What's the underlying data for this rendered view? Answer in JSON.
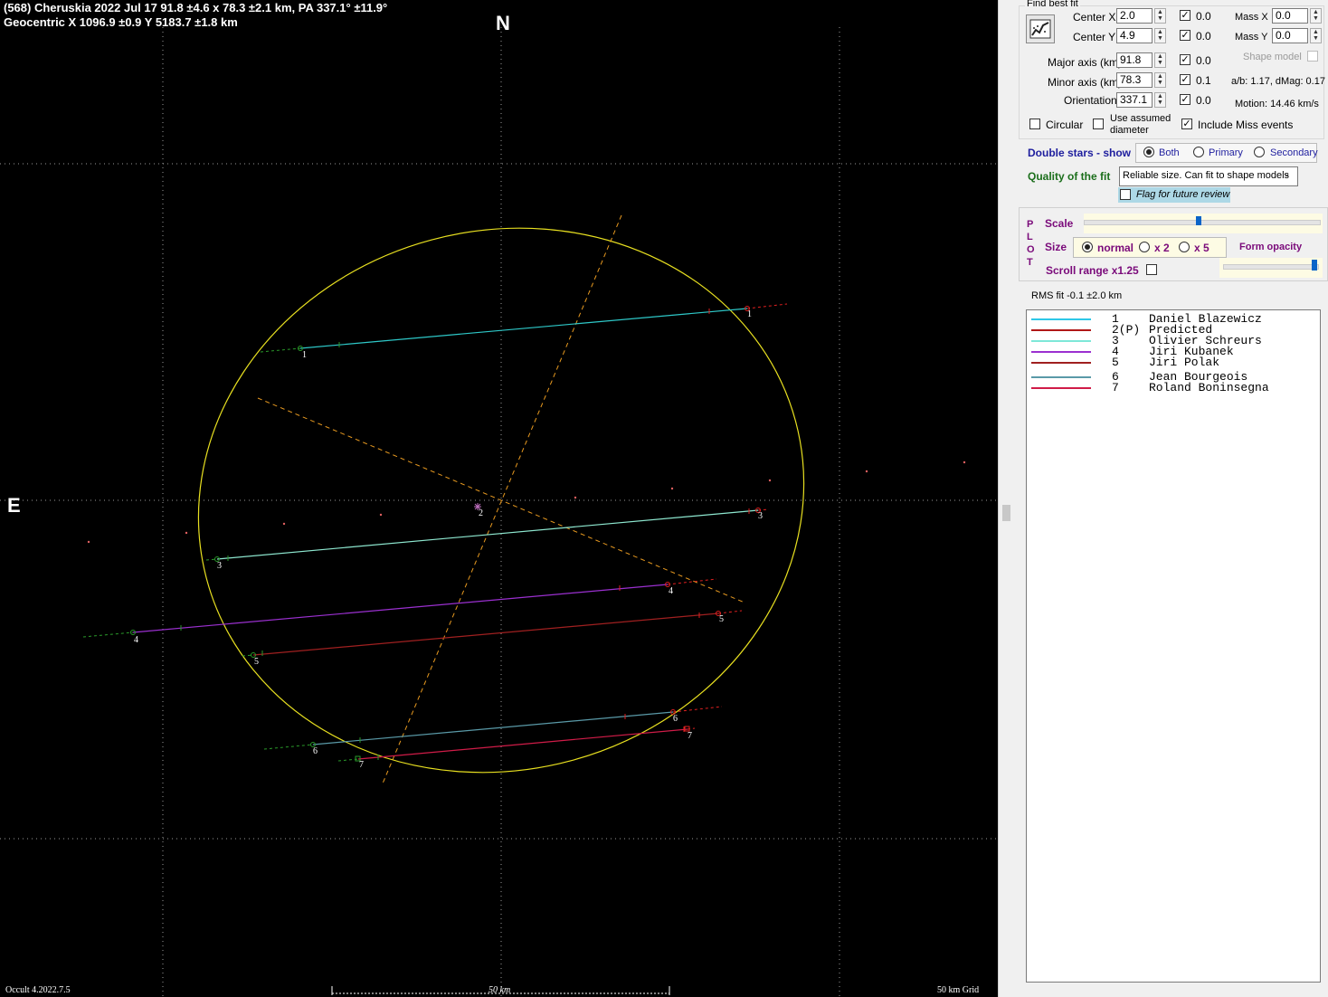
{
  "plot": {
    "title_line1": "(568) Cheruskia  2022 Jul 17  91.8 ±4.6 x 78.3 ±2.1 km, PA 337.1° ±11.9°",
    "title_line2": "Geocentric  X  1096.9 ±0.9  Y 5183.7 ±1.8 km",
    "north_label": "N",
    "east_label": "E",
    "version_label": "Occult 4.2022.7.5",
    "scale_bar_label": "50 km",
    "grid_label": "50 km Grid",
    "chords": [
      {
        "id": "1",
        "color": "#2ec8c8"
      },
      {
        "id": "3",
        "color": "#8ee8d0"
      },
      {
        "id": "4",
        "color": "#9b30d0"
      },
      {
        "id": "5",
        "color": "#a02020"
      },
      {
        "id": "6",
        "color": "#5a9aa8"
      },
      {
        "id": "7",
        "color": "#d01c48"
      }
    ],
    "predicted_label": "2",
    "ellipse_color": "#e8e020"
  },
  "panel": {
    "find_best_fit": "Find best fit",
    "center_x": {
      "label": "Center X",
      "value": "2.0",
      "check_value": "0.0"
    },
    "center_y": {
      "label": "Center Y",
      "value": "4.9",
      "check_value": "0.0"
    },
    "mass_x": {
      "label": "Mass X",
      "value": "0.0"
    },
    "mass_y": {
      "label": "Mass Y",
      "value": "0.0"
    },
    "shape_model": "Shape model",
    "major_axis": {
      "label": "Major axis (km)",
      "value": "91.8",
      "check_value": "0.0"
    },
    "minor_axis": {
      "label": "Minor axis (km)",
      "value": "78.3",
      "check_value": "0.1"
    },
    "orientation": {
      "label": "Orientation",
      "value": "337.1",
      "check_value": "0.0"
    },
    "ab_info": "a/b: 1.17, dMag: 0.17",
    "motion": "Motion: 14.46 km/s",
    "circular": "Circular",
    "use_assumed_1": "Use assumed",
    "use_assumed_2": "diameter",
    "include_miss": "Include Miss events",
    "double_stars_label": "Double stars - show",
    "double_options": [
      "Both",
      "Primary",
      "Secondary"
    ],
    "quality_label": "Quality of the fit",
    "quality_value": "Reliable size. Can fit to shape models",
    "flag_review": "Flag for future review",
    "plot_letters": [
      "P",
      "L",
      "O",
      "T"
    ],
    "scale_label": "Scale",
    "size_label": "Size",
    "size_options": [
      "normal",
      "x 2",
      "x 5"
    ],
    "form_opacity": "Form opacity",
    "scroll_range": "Scroll range x1.25",
    "rms_fit": "RMS fit -0.1 ±2.0 km"
  },
  "legend": [
    {
      "num": "1",
      "name": "Daniel Blazewicz",
      "color": "#2ec8e8"
    },
    {
      "num": "2(P)",
      "name": "Predicted",
      "color": "#b01818"
    },
    {
      "num": "3",
      "name": "Olivier Schreurs",
      "color": "#7ee8d8"
    },
    {
      "num": "4",
      "name": "Jiri Kubanek",
      "color": "#9b30d0"
    },
    {
      "num": "5",
      "name": "Jiri Polak",
      "color": "#a02020"
    },
    {
      "num": "6",
      "name": "Jean Bourgeois",
      "color": "#5a9aa8"
    },
    {
      "num": "7",
      "name": "Roland Boninsegna",
      "color": "#d01c48"
    }
  ]
}
